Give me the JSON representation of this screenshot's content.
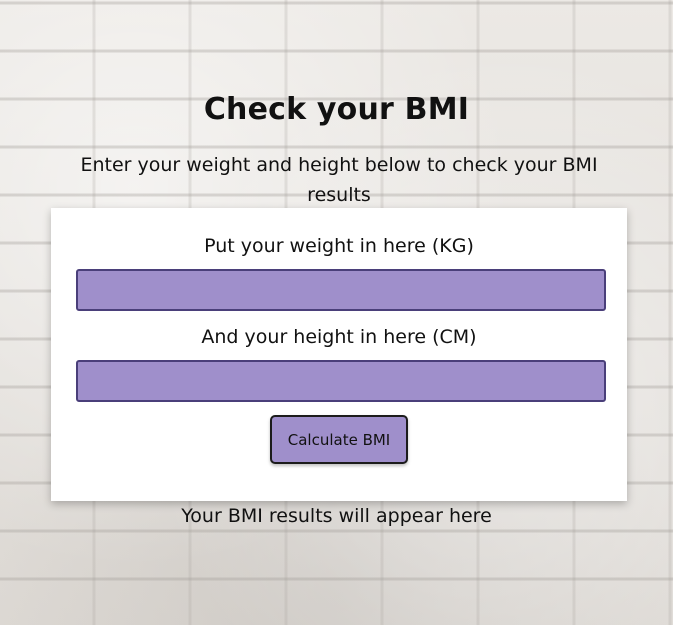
{
  "page": {
    "title": "Check your BMI",
    "subtitle": "Enter your weight and height below to check your BMI results"
  },
  "form": {
    "weight_label": "Put your weight in here (KG)",
    "weight_value": "",
    "height_label": "And your height in here (CM)",
    "height_value": "",
    "calculate_label": "Calculate BMI"
  },
  "results": {
    "text": "Your BMI results will appear here"
  },
  "colors": {
    "input_fill": "#9f8fcb",
    "input_border": "#4a3f7a",
    "card_background": "#ffffff"
  }
}
